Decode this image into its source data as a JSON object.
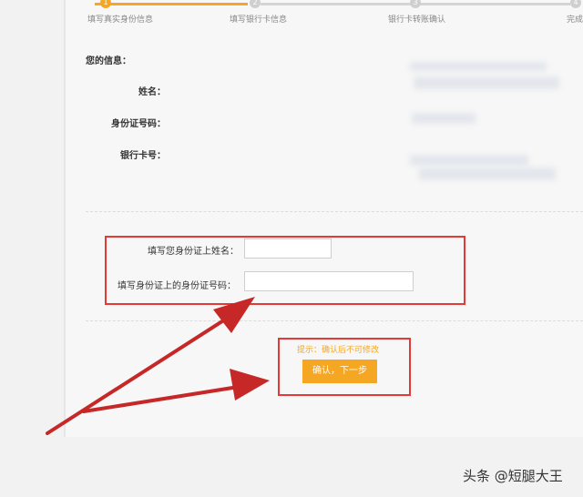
{
  "steps": [
    {
      "num": "1",
      "label": "填写真实身份信息",
      "state": "active"
    },
    {
      "num": "2",
      "label": "填写银行卡信息",
      "state": "inactive"
    },
    {
      "num": "3",
      "label": "银行卡转账确认",
      "state": "inactive"
    },
    {
      "num": "4",
      "label": "完成",
      "state": "inactive"
    }
  ],
  "info": {
    "title": "您的信息：",
    "name_label": "姓名：",
    "id_label": "身份证号码：",
    "card_label": "银行卡号："
  },
  "form": {
    "name_label": "填写您身份证上姓名：",
    "name_value": "",
    "id_label": "填写身份证上的身份证号码：",
    "id_value": ""
  },
  "tip": "提示：确认后不可修改",
  "confirm_button": "确认，下一步",
  "watermark": "头条 @短腿大王",
  "colors": {
    "accent": "#f5a623",
    "annotation": "#e53935",
    "arrow": "#c62828"
  }
}
